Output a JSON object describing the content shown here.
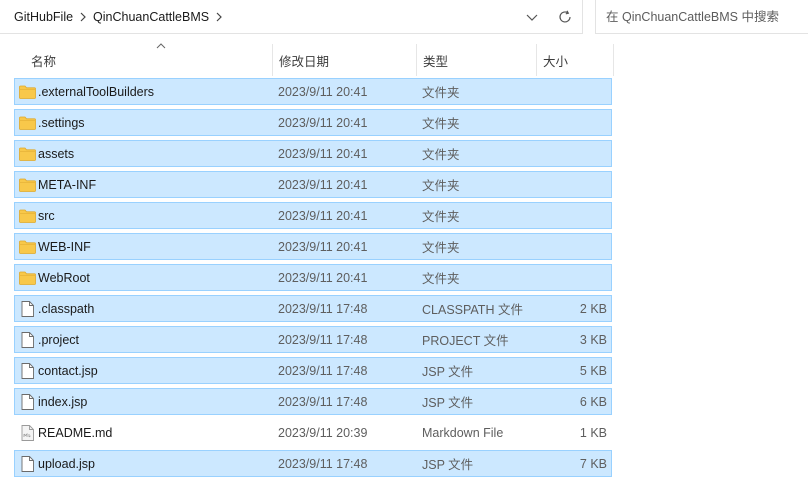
{
  "address_bar": {
    "crumbs": [
      "GitHubFile",
      "QinChuanCattleBMS"
    ],
    "dropdown_icon": "chevron-down-icon",
    "refresh_icon": "refresh-icon"
  },
  "search": {
    "placeholder": "在 QinChuanCattleBMS 中搜索"
  },
  "columns": {
    "name": "名称",
    "date": "修改日期",
    "type": "类型",
    "size": "大小",
    "sorted_by": "name",
    "sort_direction": "ascending"
  },
  "colors": {
    "selection_bg": "#cce8ff",
    "selection_border": "#99d1ff",
    "folder": "#f8c84a"
  },
  "files": [
    {
      "name": ".externalToolBuilders",
      "date": "2023/9/11 20:41",
      "type": "文件夹",
      "size": "",
      "icon": "folder-icon",
      "selected": true
    },
    {
      "name": ".settings",
      "date": "2023/9/11 20:41",
      "type": "文件夹",
      "size": "",
      "icon": "folder-icon",
      "selected": true
    },
    {
      "name": "assets",
      "date": "2023/9/11 20:41",
      "type": "文件夹",
      "size": "",
      "icon": "folder-icon",
      "selected": true
    },
    {
      "name": "META-INF",
      "date": "2023/9/11 20:41",
      "type": "文件夹",
      "size": "",
      "icon": "folder-icon",
      "selected": true
    },
    {
      "name": "src",
      "date": "2023/9/11 20:41",
      "type": "文件夹",
      "size": "",
      "icon": "folder-icon",
      "selected": true
    },
    {
      "name": "WEB-INF",
      "date": "2023/9/11 20:41",
      "type": "文件夹",
      "size": "",
      "icon": "folder-icon",
      "selected": true
    },
    {
      "name": "WebRoot",
      "date": "2023/9/11 20:41",
      "type": "文件夹",
      "size": "",
      "icon": "folder-icon",
      "selected": true
    },
    {
      "name": ".classpath",
      "date": "2023/9/11 17:48",
      "type": "CLASSPATH 文件",
      "size": "2 KB",
      "icon": "file-icon",
      "selected": true
    },
    {
      "name": ".project",
      "date": "2023/9/11 17:48",
      "type": "PROJECT 文件",
      "size": "3 KB",
      "icon": "file-icon",
      "selected": true
    },
    {
      "name": "contact.jsp",
      "date": "2023/9/11 17:48",
      "type": "JSP 文件",
      "size": "5 KB",
      "icon": "file-icon",
      "selected": true
    },
    {
      "name": "index.jsp",
      "date": "2023/9/11 17:48",
      "type": "JSP 文件",
      "size": "6 KB",
      "icon": "file-icon",
      "selected": true
    },
    {
      "name": "README.md",
      "date": "2023/9/11 20:39",
      "type": "Markdown File",
      "size": "1 KB",
      "icon": "markdown-file-icon",
      "selected": false
    },
    {
      "name": "upload.jsp",
      "date": "2023/9/11 17:48",
      "type": "JSP 文件",
      "size": "7 KB",
      "icon": "file-icon",
      "selected": true
    }
  ]
}
